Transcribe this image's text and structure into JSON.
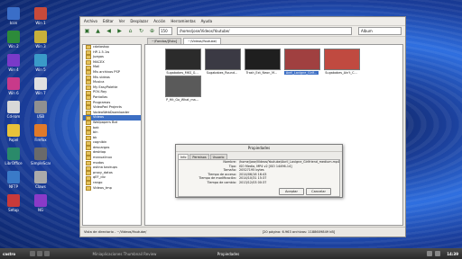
{
  "desktop_icons": [
    {
      "label": "Icon",
      "color": "#3a6ec8"
    },
    {
      "label": "Win 1",
      "color": "#c84a3a"
    },
    {
      "label": "Win 2",
      "color": "#2d8a3a"
    },
    {
      "label": "Win 3",
      "color": "#c8b03a"
    },
    {
      "label": "Win 4",
      "color": "#7a3ac8"
    },
    {
      "label": "Win 5",
      "color": "#3a9ac8"
    },
    {
      "label": "Win 6",
      "color": "#c83a8a"
    },
    {
      "label": "Win 7",
      "color": "#e0e0e0"
    },
    {
      "label": "Cd-rom",
      "color": "#d8d8d8"
    },
    {
      "label": "USB",
      "color": "#909090"
    },
    {
      "label": "Papel",
      "color": "#e8c23a"
    },
    {
      "label": "Firefox",
      "color": "#e07a2a"
    },
    {
      "label": "LibrOffice",
      "color": "#2a8a6a"
    },
    {
      "label": "SimpleScan",
      "color": "#6a6a6a"
    },
    {
      "label": "NFTP",
      "color": "#3a7ac8"
    },
    {
      "label": "Claws",
      "color": "#aaaaaa"
    },
    {
      "label": "Setup",
      "color": "#c83a3a"
    },
    {
      "label": "NG",
      "color": "#8a3ac8"
    }
  ],
  "menubar": [
    "Archivo",
    "Editar",
    "Ver",
    "Desplazar",
    "Acción",
    "Herramientas",
    "Ayuda"
  ],
  "toolbar": {
    "zoom": "150",
    "path": "/home/jose/Videos/Youtube/",
    "view": "Album"
  },
  "tabs": [
    "~/Fondos/[Esto]",
    "~/Videos/Youtube/"
  ],
  "tree": [
    "cdatastop",
    "HP-1.5.1w",
    "Juegos",
    "MACEX",
    "Mail",
    "Mis archivos PSP",
    "Mis videos",
    "Musica",
    "My EasyPalette",
    "POV-Ray",
    "Pantallas",
    "Programas",
    "VideoPad Projects",
    "VodeoWebDownloader",
    "Videos",
    "Wallpapers Bot",
    "bak",
    "bin",
    "bk",
    "cognibin",
    "descargas",
    "desktop",
    "manualinux",
    "modos",
    "ostina backups",
    "proxy_datos",
    "qEF_div",
    "rango",
    "Videos_tmp"
  ],
  "tree_selected": 14,
  "thumbnails": [
    {
      "caption": "Sugababes_MKS_G...",
      "color": "#2b2b2b"
    },
    {
      "caption": "Sugababes_Round...",
      "color": "#3b3a44"
    },
    {
      "caption": "Trash_Ext_Neon_M...",
      "color": "#1f1f1f"
    },
    {
      "caption": "Avril_Lavigne_Girlf...",
      "color": "#a04040"
    },
    {
      "caption": "Sugababes_Ain't_C...",
      "color": "#c04a40"
    },
    {
      "caption": "P_Hit_Go_What_ma...",
      "color": "#5a5a5a"
    }
  ],
  "status": {
    "left": "Vista de directorio - ~/Videos/Youtube/",
    "right": "[20 página: 6.963 archivos: 1188609849 kB]"
  },
  "dialog": {
    "title": "Propiedades",
    "tabs": [
      "Info",
      "Permisos",
      "Usuario"
    ],
    "rows": [
      {
        "k": "Nombre:",
        "v": "/home/jose/Videos/Youtube/Avril_Lavigne_Girlfriend_medium.mp4"
      },
      {
        "k": "Tipo:",
        "v": "ISO Media, MP4 v2 [ISO 14496-14]"
      },
      {
        "k": "Tamaño:",
        "v": "20527195 bytes"
      },
      {
        "k": "Tiempo de acceso:",
        "v": "2014/06/16 16:43"
      },
      {
        "k": "Tiempo de modificación:",
        "v": "2014/10/31 15:37"
      },
      {
        "k": "Tiempo de cambio:",
        "v": "2013/12/03 00:37"
      }
    ],
    "accept": "Aceptar",
    "cancel": "Cancelar"
  },
  "taskbar": {
    "start": "castro",
    "item1": "Miniaplicaciones Thumbnail Review",
    "item2": "Propiedades",
    "clock": "14:39"
  }
}
